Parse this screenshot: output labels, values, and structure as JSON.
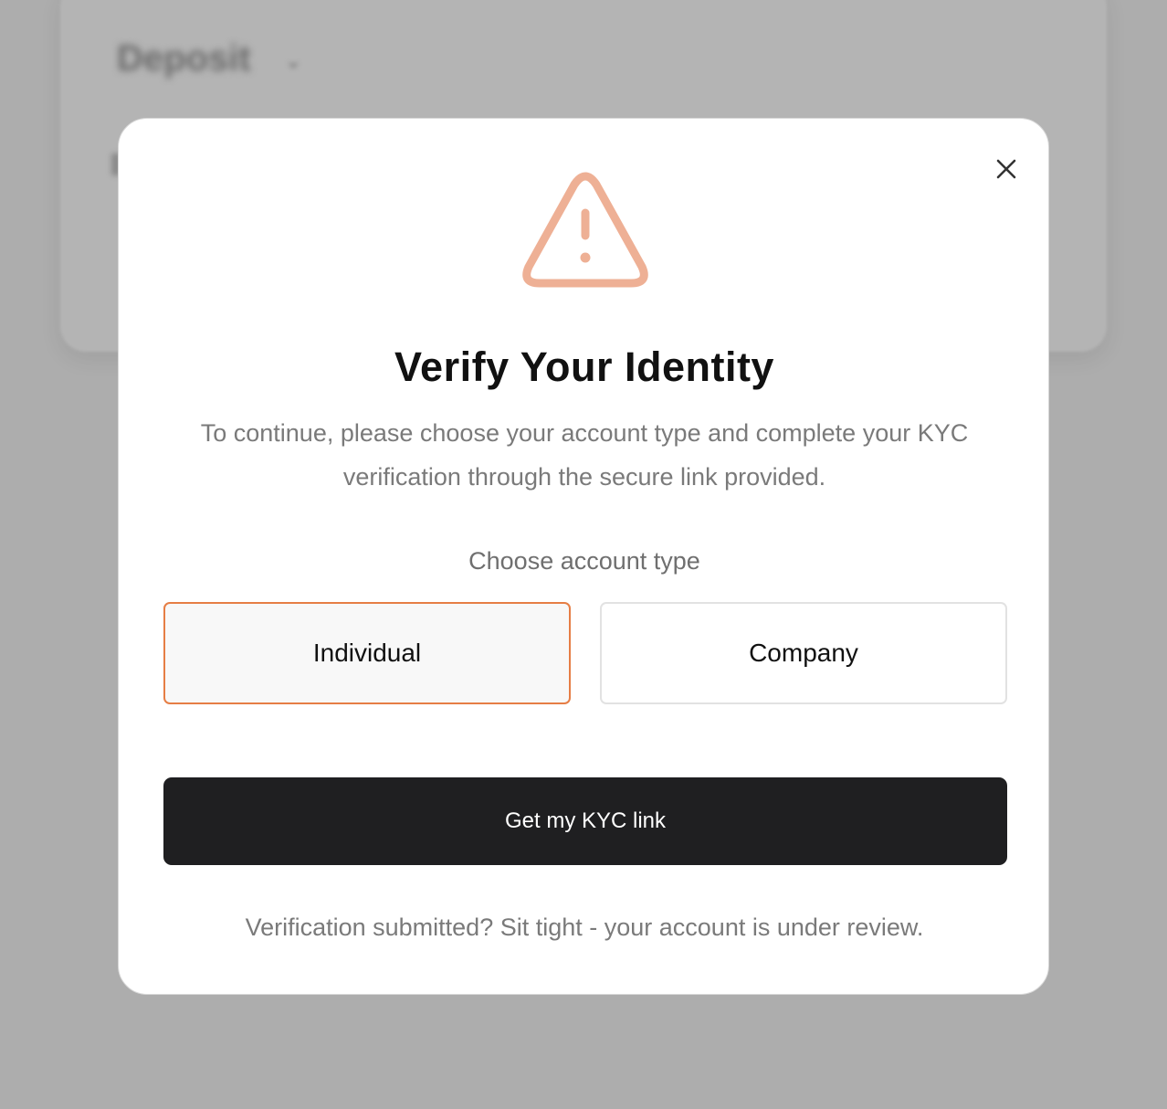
{
  "background": {
    "title": "Deposit",
    "chevron_icon": "chevron-down-icon"
  },
  "modal": {
    "close_icon": "close-icon",
    "warning_icon": "warning-triangle-icon",
    "warning_color": "#EEB095",
    "title": "Verify Your Identity",
    "description": "To continue, please choose your account type and complete your KYC verification through the secure link provided.",
    "account_type_label": "Choose account type",
    "options": [
      {
        "label": "Individual",
        "selected": true
      },
      {
        "label": "Company",
        "selected": false
      }
    ],
    "selected_accent": "#E67E45",
    "primary_button_label": "Get my KYC link",
    "primary_button_color": "#1F1F21",
    "footer_note": "Verification submitted? Sit tight - your account is under review."
  }
}
